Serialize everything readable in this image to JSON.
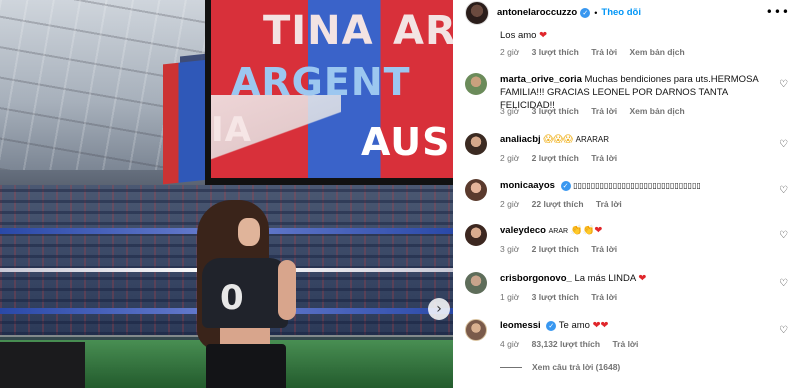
{
  "photo": {
    "board_texts": [
      "TINA",
      "ARG",
      "ARGENT",
      "IA",
      "AUS"
    ],
    "next_icon": "chevron-right-icon"
  },
  "header": {
    "username": "antonelaroccuzzo",
    "separator": "•",
    "follow_label": "Theo dõi",
    "more_icon": "•••"
  },
  "comments": [
    {
      "user": "",
      "text": "Los amo",
      "emoji": "❤",
      "time": "2 giờ",
      "likes": "3 lượt thích",
      "reply": "Trả lời",
      "translate": "Xem bản dịch",
      "verified": false
    },
    {
      "user": "marta_orive_coria",
      "text": "Muchas bendiciones para uts.HERMOSA FAMILIA!!! GRACIAS LEONEL POR DARNOS TANTA FELICIDAD!!",
      "emoji": "",
      "time": "3 giờ",
      "likes": "3 lượt thích",
      "reply": "Trả lời",
      "translate": "Xem bản dịch",
      "verified": false
    },
    {
      "user": "analiacbj",
      "text": "ARARAR",
      "emoji": "😱😱😱",
      "time": "2 giờ",
      "likes": "2 lượt thích",
      "reply": "Trả lời",
      "translate": "",
      "verified": false
    },
    {
      "user": "monicaayos",
      "text": "▯▯▯▯▯▯▯▯▯▯▯▯▯▯▯▯▯▯▯▯▯▯▯▯▯▯▯▯▯",
      "emoji": "",
      "time": "2 giờ",
      "likes": "22 lượt thích",
      "reply": "Trả lời",
      "translate": "",
      "verified": true
    },
    {
      "user": "valeydeco",
      "text": "ARAR",
      "emoji": "👏👏❤",
      "time": "3 giờ",
      "likes": "2 lượt thích",
      "reply": "Trả lời",
      "translate": "",
      "verified": false
    },
    {
      "user": "crisborgonovo_",
      "text": "La más LINDA",
      "emoji": "❤",
      "time": "1 giờ",
      "likes": "3 lượt thích",
      "reply": "Trả lời",
      "translate": "",
      "verified": false
    },
    {
      "user": "leomessi",
      "text": "Te amo",
      "emoji": "❤❤",
      "time": "4 giờ",
      "likes": "83,132 lượt thích",
      "reply": "Trả lời",
      "translate": "",
      "verified": true
    }
  ],
  "view_replies": "Xem câu trả lời (1648)",
  "colors": {
    "accent": "#0095f6",
    "verified": "#3897f0",
    "heart": "#e0262b",
    "meta": "#737373"
  }
}
